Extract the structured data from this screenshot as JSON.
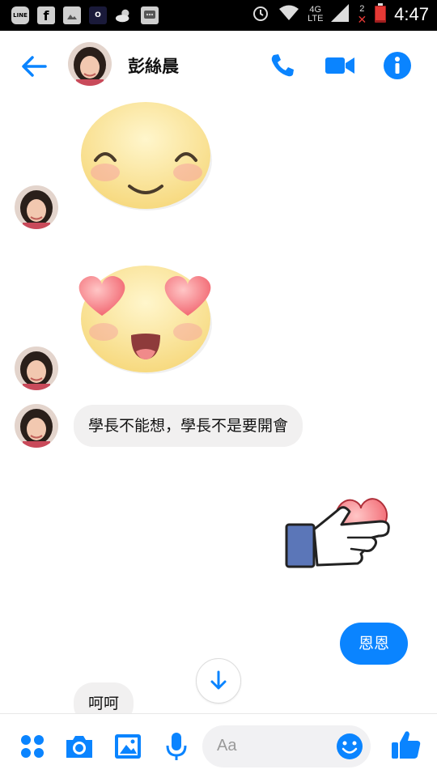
{
  "status_bar": {
    "time": "4:47",
    "network_top": "4G",
    "network_bottom": "LTE",
    "sim_badge": "2",
    "app_icons": [
      "LINE",
      "facebook",
      "gallery",
      "messenger",
      "weather",
      "chat"
    ]
  },
  "header": {
    "contact_name": "彭絲晨",
    "back_icon": "back-arrow-icon",
    "call_icon": "phone-icon",
    "video_icon": "video-camera-icon",
    "info_icon": "info-icon"
  },
  "messages": [
    {
      "from": "contact",
      "type": "sticker",
      "sticker": "smiling-face-sticker"
    },
    {
      "from": "contact",
      "type": "sticker",
      "sticker": "heart-eyes-face-sticker"
    },
    {
      "from": "contact",
      "type": "text",
      "text": "學長不能想，學長不是要開會"
    },
    {
      "from": "me",
      "type": "sticker",
      "sticker": "thumbs-up-heart-sticker"
    },
    {
      "from": "me",
      "type": "text",
      "text": "恩恩"
    },
    {
      "from": "contact",
      "type": "text",
      "text": "呵呵"
    }
  ],
  "composer": {
    "placeholder": "Aa",
    "icons": [
      "more-icon",
      "camera-icon",
      "image-icon",
      "microphone-icon",
      "emoji-icon",
      "like-icon"
    ]
  },
  "colors": {
    "accent": "#0a84ff",
    "incoming_bubble": "#f1f0f0",
    "status_bar": "#000000"
  }
}
